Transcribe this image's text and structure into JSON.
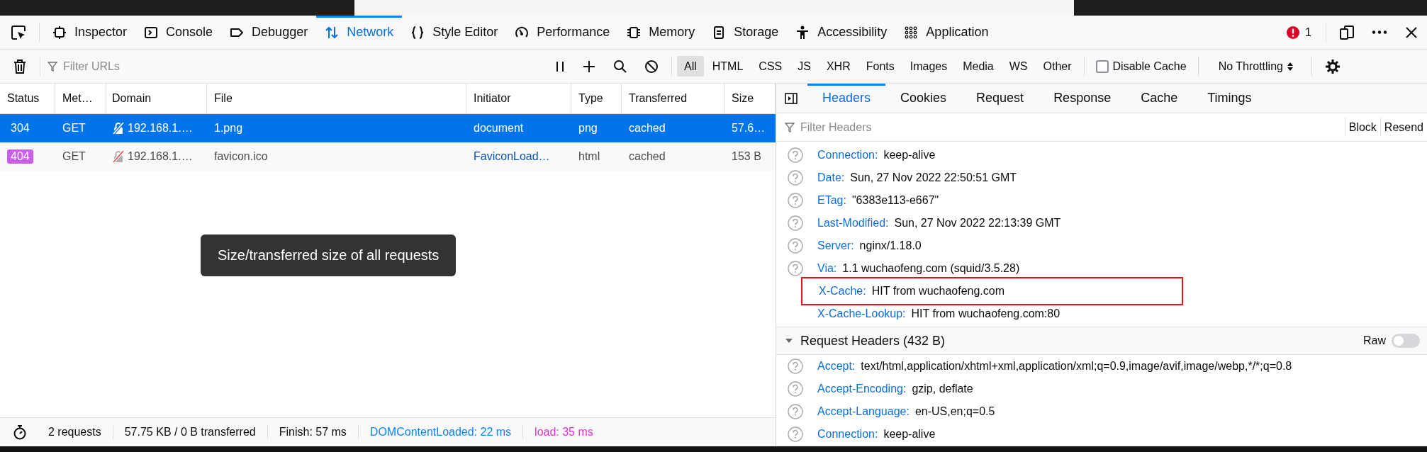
{
  "toolbar": {
    "tabs": [
      {
        "label": "Inspector",
        "selected": false
      },
      {
        "label": "Console",
        "selected": false
      },
      {
        "label": "Debugger",
        "selected": false
      },
      {
        "label": "Network",
        "selected": true
      },
      {
        "label": "Style Editor",
        "selected": false
      },
      {
        "label": "Performance",
        "selected": false
      },
      {
        "label": "Memory",
        "selected": false
      },
      {
        "label": "Storage",
        "selected": false
      },
      {
        "label": "Accessibility",
        "selected": false
      },
      {
        "label": "Application",
        "selected": false
      }
    ],
    "error_count": "1"
  },
  "filter_bar": {
    "placeholder": "Filter URLs",
    "type_filters": [
      {
        "label": "All",
        "selected": true
      },
      {
        "label": "HTML",
        "selected": false
      },
      {
        "label": "CSS",
        "selected": false
      },
      {
        "label": "JS",
        "selected": false
      },
      {
        "label": "XHR",
        "selected": false
      },
      {
        "label": "Fonts",
        "selected": false
      },
      {
        "label": "Images",
        "selected": false
      },
      {
        "label": "Media",
        "selected": false
      },
      {
        "label": "WS",
        "selected": false
      },
      {
        "label": "Other",
        "selected": false
      }
    ],
    "disable_cache": {
      "label": "Disable Cache",
      "checked": false
    },
    "throttling": "No Throttling"
  },
  "table": {
    "columns": [
      "Status",
      "Met…",
      "Domain",
      "File",
      "Initiator",
      "Type",
      "Transferred",
      "Size"
    ],
    "rows": [
      {
        "status": "304",
        "status_badge": false,
        "method": "GET",
        "domain": "192.168.1.…",
        "file": "1.png",
        "initiator": "document",
        "initiator_link": false,
        "type": "png",
        "transferred": "cached",
        "size": "57.6…",
        "selected": true
      },
      {
        "status": "404",
        "status_badge": true,
        "method": "GET",
        "domain": "192.168.1.…",
        "file": "favicon.ico",
        "initiator": "FaviconLoad…",
        "initiator_link": true,
        "type": "html",
        "transferred": "cached",
        "size": "153 B",
        "selected": false
      }
    ]
  },
  "tooltip": "Size/transferred size of all requests",
  "status_bar": [
    {
      "text": "2 requests",
      "color": "#0c0c0d"
    },
    {
      "text": "57.75 KB / 0 B transferred",
      "color": "#0c0c0d"
    },
    {
      "text": "Finish: 57 ms",
      "color": "#0c0c0d"
    },
    {
      "text": "DOMContentLoaded: 22 ms",
      "color": "#0a84ff"
    },
    {
      "text": "load: 35 ms",
      "color": "#e230d4"
    }
  ],
  "details": {
    "tabs": [
      {
        "label": "Headers",
        "selected": true
      },
      {
        "label": "Cookies",
        "selected": false
      },
      {
        "label": "Request",
        "selected": false
      },
      {
        "label": "Response",
        "selected": false
      },
      {
        "label": "Cache",
        "selected": false
      },
      {
        "label": "Timings",
        "selected": false
      }
    ],
    "filter_placeholder": "Filter Headers",
    "buttons": [
      "Block",
      "Resend"
    ],
    "response_headers": [
      {
        "name": "Connection:",
        "value": "keep-alive",
        "help": true,
        "highlighted": false
      },
      {
        "name": "Date:",
        "value": "Sun, 27 Nov 2022 22:50:51 GMT",
        "help": true,
        "highlighted": false
      },
      {
        "name": "ETag:",
        "value": "\"6383e113-e667\"",
        "help": true,
        "highlighted": false
      },
      {
        "name": "Last-Modified:",
        "value": "Sun, 27 Nov 2022 22:13:39 GMT",
        "help": true,
        "highlighted": false
      },
      {
        "name": "Server:",
        "value": "nginx/1.18.0",
        "help": true,
        "highlighted": false
      },
      {
        "name": "Via:",
        "value": "1.1 wuchaofeng.com (squid/3.5.28)",
        "help": true,
        "highlighted": false
      },
      {
        "name": "X-Cache:",
        "value": "HIT from wuchaofeng.com",
        "help": false,
        "highlighted": true
      },
      {
        "name": "X-Cache-Lookup:",
        "value": "HIT from wuchaofeng.com:80",
        "help": false,
        "highlighted": false
      }
    ],
    "request_section": {
      "title": "Request Headers (432 B)",
      "expanded": true,
      "raw_label": "Raw",
      "raw_on": false,
      "headers": [
        {
          "name": "Accept:",
          "value": "text/html,application/xhtml+xml,application/xml;q=0.9,image/avif,image/webp,*/*;q=0.8",
          "help": true,
          "highlighted": false
        },
        {
          "name": "Accept-Encoding:",
          "value": "gzip, deflate",
          "help": true,
          "highlighted": false
        },
        {
          "name": "Accept-Language:",
          "value": "en-US,en;q=0.5",
          "help": true,
          "highlighted": false
        },
        {
          "name": "Connection:",
          "value": "keep-alive",
          "help": true,
          "highlighted": false
        }
      ]
    }
  }
}
